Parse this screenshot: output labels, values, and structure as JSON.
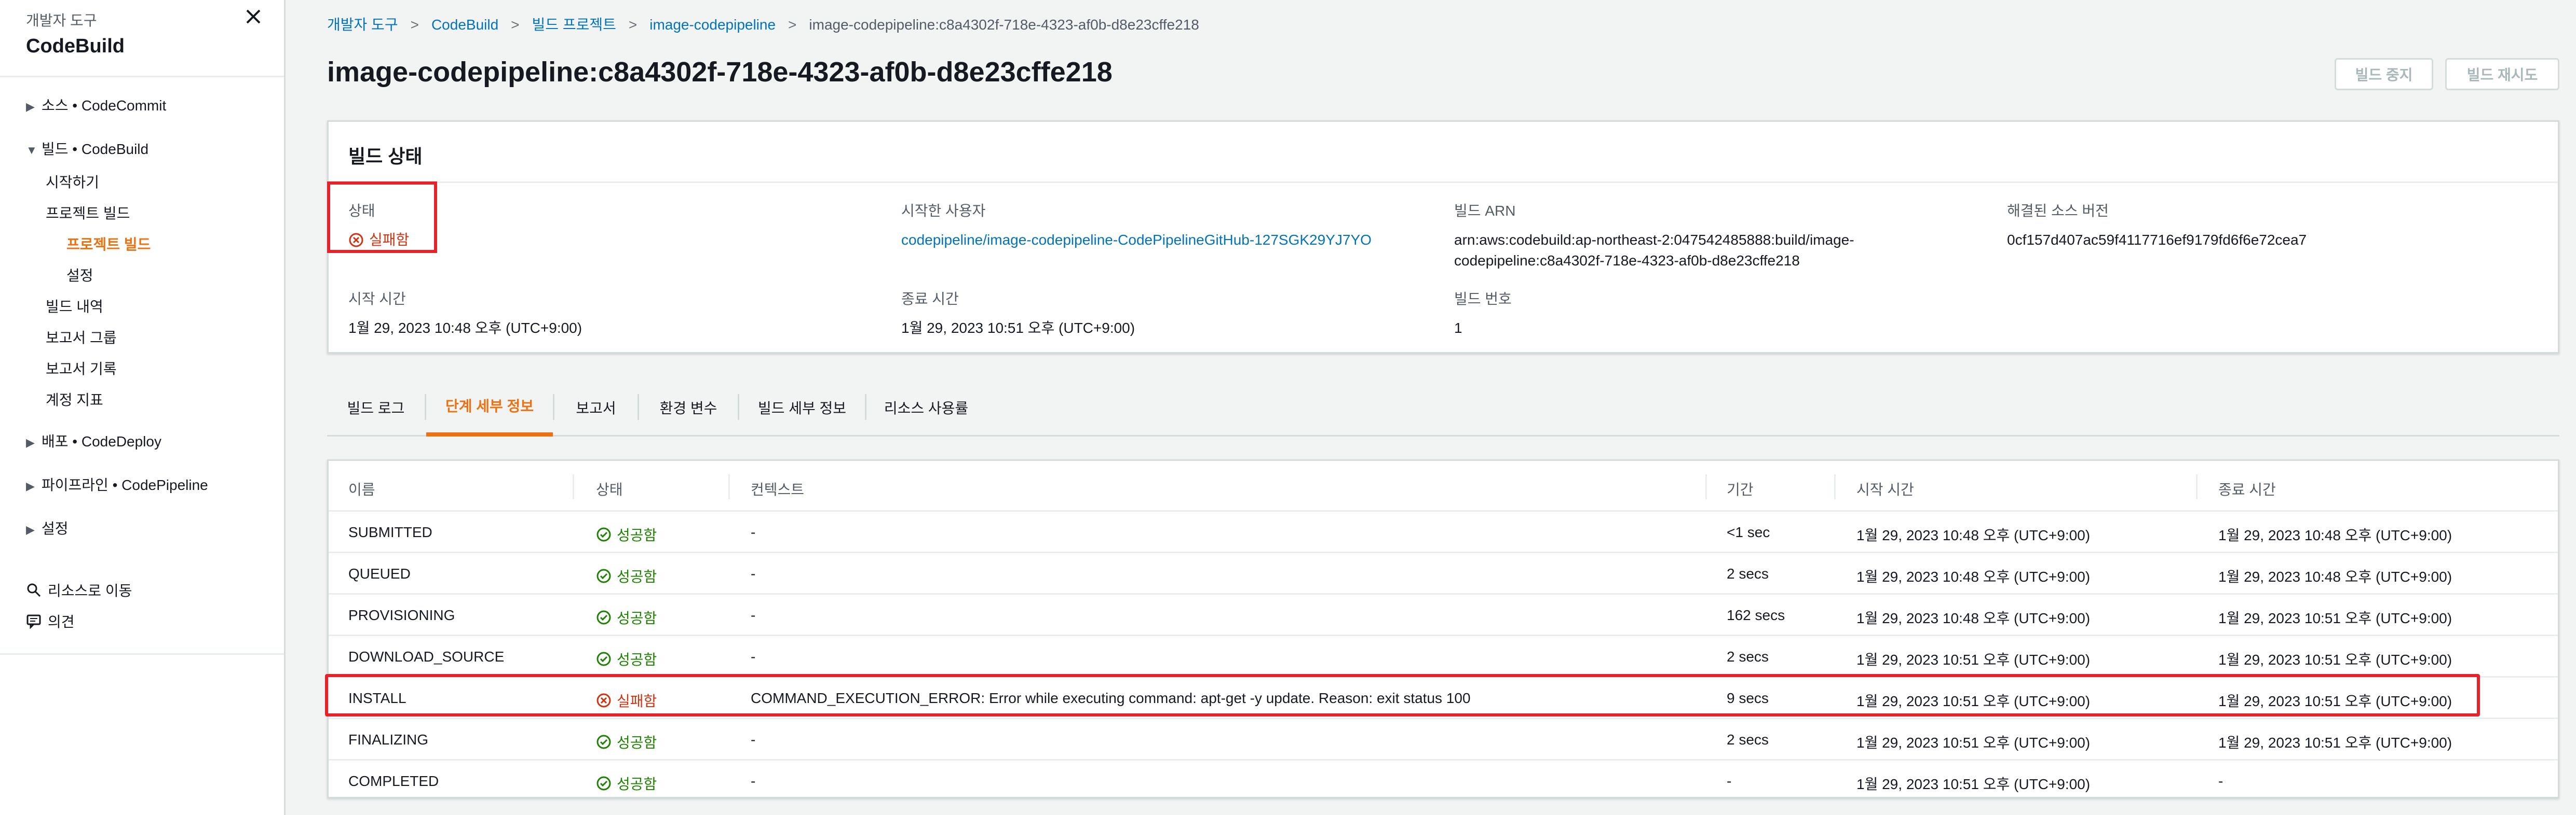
{
  "sidebar": {
    "parent": "개발자 도구",
    "title": "CodeBuild",
    "sections": [
      {
        "label": "소스 • CodeCommit",
        "expanded": false
      },
      {
        "label": "빌드 • CodeBuild",
        "expanded": true,
        "items": [
          {
            "label": "시작하기"
          },
          {
            "label": "프로젝트 빌드",
            "children": [
              {
                "label": "프로젝트 빌드",
                "active": true
              },
              {
                "label": "설정"
              }
            ]
          },
          {
            "label": "빌드 내역"
          },
          {
            "label": "보고서 그룹"
          },
          {
            "label": "보고서 기록"
          },
          {
            "label": "계정 지표"
          }
        ]
      },
      {
        "label": "배포 • CodeDeploy",
        "expanded": false
      },
      {
        "label": "파이프라인 • CodePipeline",
        "expanded": false
      },
      {
        "label": "설정",
        "expanded": false
      }
    ],
    "bottom": [
      {
        "label": "리소스로 이동",
        "icon": "search-icon"
      },
      {
        "label": "의견",
        "icon": "feedback-icon"
      }
    ]
  },
  "breadcrumb": [
    "개발자 도구",
    "CodeBuild",
    "빌드 프로젝트",
    "image-codepipeline",
    "image-codepipeline:c8a4302f-718e-4323-af0b-d8e23cffe218"
  ],
  "page_title": "image-codepipeline:c8a4302f-718e-4323-af0b-d8e23cffe218",
  "buttons": {
    "stop": "빌드 중지",
    "retry": "빌드 재시도"
  },
  "build_status": {
    "title": "빌드 상태",
    "status_label": "상태",
    "status_value": "실패함",
    "initiator_label": "시작한 사용자",
    "initiator_value": "codepipeline/image-codepipeline-CodePipelineGitHub-127SGK29YJ7YO",
    "arn_label": "빌드 ARN",
    "arn_line1": "arn:aws:codebuild:ap-northeast-2:047542485888:build/image-",
    "arn_line2": "codepipeline:c8a4302f-718e-4323-af0b-d8e23cffe218",
    "source_version_label": "해결된 소스 버전",
    "source_version_value": "0cf157d407ac59f4117716ef9179fd6f6e72cea7",
    "start_label": "시작 시간",
    "start_value": "1월 29, 2023 10:48 오후 (UTC+9:00)",
    "end_label": "종료 시간",
    "end_value": "1월 29, 2023 10:51 오후 (UTC+9:00)",
    "build_number_label": "빌드 번호",
    "build_number_value": "1"
  },
  "tabs": [
    {
      "label": "빌드 로그"
    },
    {
      "label": "단계 세부 정보",
      "active": true
    },
    {
      "label": "보고서"
    },
    {
      "label": "환경 변수"
    },
    {
      "label": "빌드 세부 정보"
    },
    {
      "label": "리소스 사용률"
    }
  ],
  "phases": {
    "columns": [
      "이름",
      "상태",
      "컨텍스트",
      "기간",
      "시작 시간",
      "종료 시간"
    ],
    "rows": [
      {
        "name": "SUBMITTED",
        "status": "성공함",
        "ok": true,
        "context": "-",
        "duration": "<1 sec",
        "start": "1월 29, 2023 10:48 오후 (UTC+9:00)",
        "end": "1월 29, 2023 10:48 오후 (UTC+9:00)"
      },
      {
        "name": "QUEUED",
        "status": "성공함",
        "ok": true,
        "context": "-",
        "duration": "2 secs",
        "start": "1월 29, 2023 10:48 오후 (UTC+9:00)",
        "end": "1월 29, 2023 10:48 오후 (UTC+9:00)"
      },
      {
        "name": "PROVISIONING",
        "status": "성공함",
        "ok": true,
        "context": "-",
        "duration": "162 secs",
        "start": "1월 29, 2023 10:48 오후 (UTC+9:00)",
        "end": "1월 29, 2023 10:51 오후 (UTC+9:00)"
      },
      {
        "name": "DOWNLOAD_SOURCE",
        "status": "성공함",
        "ok": true,
        "context": "-",
        "duration": "2 secs",
        "start": "1월 29, 2023 10:51 오후 (UTC+9:00)",
        "end": "1월 29, 2023 10:51 오후 (UTC+9:00)"
      },
      {
        "name": "INSTALL",
        "status": "실패함",
        "ok": false,
        "context": "COMMAND_EXECUTION_ERROR: Error while executing command: apt-get -y update. Reason: exit status 100",
        "duration": "9 secs",
        "start": "1월 29, 2023 10:51 오후 (UTC+9:00)",
        "end": "1월 29, 2023 10:51 오후 (UTC+9:00)"
      },
      {
        "name": "FINALIZING",
        "status": "성공함",
        "ok": true,
        "context": "-",
        "duration": "2 secs",
        "start": "1월 29, 2023 10:51 오후 (UTC+9:00)",
        "end": "1월 29, 2023 10:51 오후 (UTC+9:00)"
      },
      {
        "name": "COMPLETED",
        "status": "성공함",
        "ok": true,
        "context": "-",
        "duration": "-",
        "start": "1월 29, 2023 10:51 오후 (UTC+9:00)",
        "end": "-"
      }
    ]
  },
  "colors": {
    "link": "#0073bb",
    "accent": "#ec7211",
    "success": "#1d8102",
    "error": "#d13212",
    "highlight": "#e4232a"
  }
}
